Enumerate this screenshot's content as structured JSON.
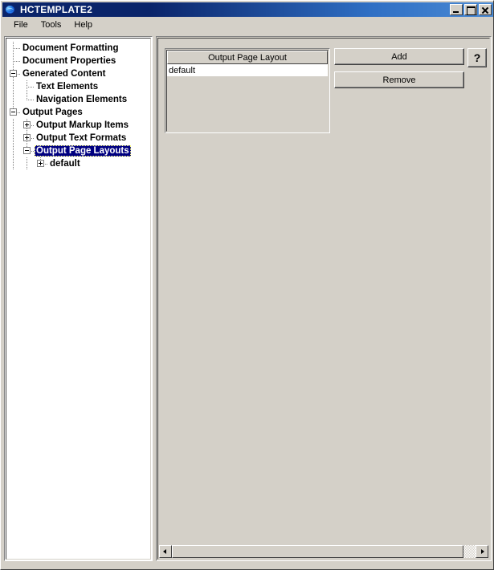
{
  "window": {
    "title": "HCTEMPLATE2",
    "icon": "globe-icon",
    "minimize_label": "Minimize",
    "maximize_label": "Maximize",
    "close_label": "Close"
  },
  "menu": {
    "items": [
      {
        "label": "File"
      },
      {
        "label": "Tools"
      },
      {
        "label": "Help"
      }
    ]
  },
  "tree": {
    "nodes": [
      {
        "label": "Document Formatting",
        "depth": 0,
        "expander": "none",
        "selected": false
      },
      {
        "label": "Document Properties",
        "depth": 0,
        "expander": "none",
        "selected": false
      },
      {
        "label": "Generated Content",
        "depth": 0,
        "expander": "minus",
        "selected": false
      },
      {
        "label": "Text Elements",
        "depth": 1,
        "expander": "none",
        "selected": false
      },
      {
        "label": "Navigation Elements",
        "depth": 1,
        "expander": "none",
        "selected": false
      },
      {
        "label": "Output Pages",
        "depth": 0,
        "expander": "minus",
        "selected": false
      },
      {
        "label": "Output Markup Items",
        "depth": 1,
        "expander": "plus",
        "selected": false
      },
      {
        "label": "Output Text Formats",
        "depth": 1,
        "expander": "plus",
        "selected": false
      },
      {
        "label": "Output Page Layouts",
        "depth": 1,
        "expander": "minus",
        "selected": true
      },
      {
        "label": "default",
        "depth": 2,
        "expander": "plus",
        "selected": false
      }
    ]
  },
  "main": {
    "list": {
      "header": "Output Page Layout",
      "rows": [
        {
          "name": "default"
        }
      ]
    },
    "buttons": {
      "add": "Add",
      "remove": "Remove",
      "help": "?"
    },
    "scrollbar": {
      "left_arrow": "◀",
      "right_arrow": "▶"
    }
  },
  "colors": {
    "face": "#d4d0c8",
    "title_active_start": "#0a246a",
    "title_active_end": "#4a8ad4",
    "selection": "#000080",
    "selection_text": "#ffffff",
    "window_bg": "#ffffff",
    "text": "#000000"
  }
}
